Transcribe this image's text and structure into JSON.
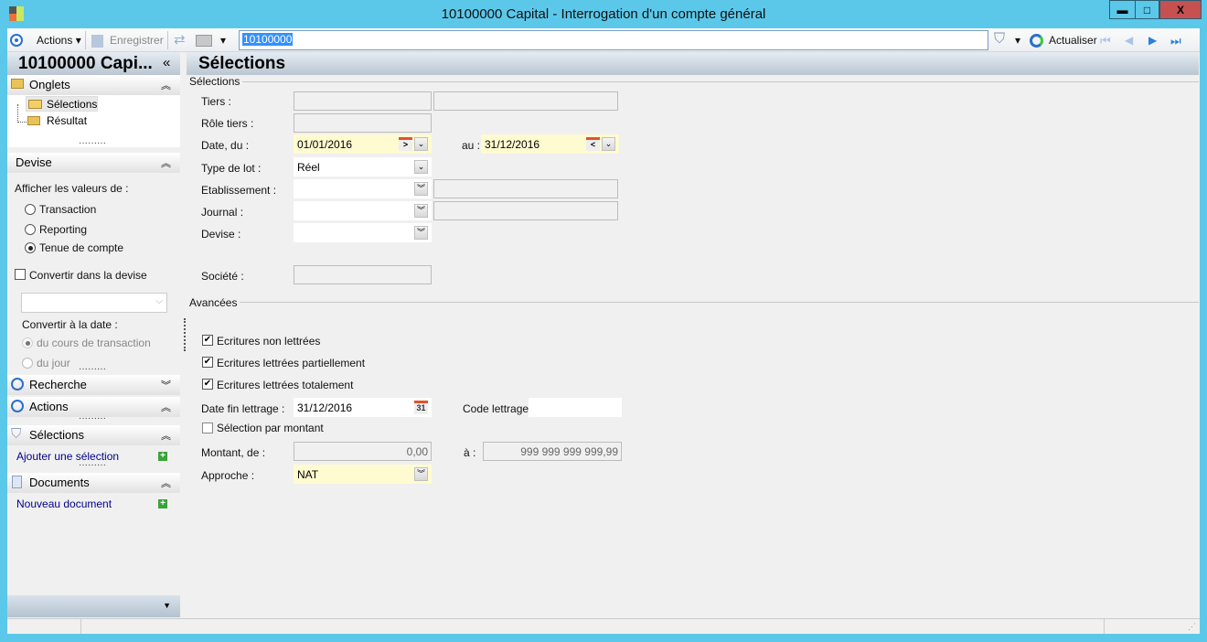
{
  "window": {
    "title": "10100000 Capital -  Interrogation d'un compte général",
    "minimize": "▬",
    "maximize": "□",
    "close": "X"
  },
  "toolbar": {
    "actions": "Actions",
    "save": "Enregistrer",
    "search_value": "10100000",
    "refresh": "Actualiser"
  },
  "left": {
    "title": "10100000 Capi...",
    "collapse": "«",
    "onglets": {
      "label": "Onglets",
      "items": [
        "Sélections",
        "Résultat"
      ]
    },
    "devise": {
      "label": "Devise",
      "afficher": "Afficher les valeurs de :",
      "options": [
        "Transaction",
        "Reporting",
        "Tenue de compte"
      ],
      "selected": 2,
      "convertir": "Convertir dans la devise",
      "convertir_date": "Convertir à la date :",
      "date_options": [
        "du cours de transaction",
        "du jour"
      ]
    },
    "recherche": "Recherche",
    "actions": "Actions",
    "selections": "Sélections",
    "add_selection": "Ajouter une sélection",
    "documents": "Documents",
    "new_document": "Nouveau document"
  },
  "main": {
    "title": "Sélections",
    "section1": "Sélections",
    "section2": "Avancées",
    "tiers": "Tiers :",
    "role": "Rôle tiers :",
    "date_du": "Date, du :",
    "date_from": "01/01/2016",
    "au": "au :",
    "date_to": "31/12/2016",
    "type_lot": "Type de lot :",
    "type_lot_value": "Réel",
    "etab": "Etablissement :",
    "journal": "Journal :",
    "devise": "Devise :",
    "societe": "Société :",
    "chk1": "Ecritures non lettrées",
    "chk2": "Ecritures lettrées partiellement",
    "chk3": "Ecritures lettrées totalement",
    "date_fin": "Date fin lettrage :",
    "date_fin_value": "31/12/2016",
    "cal_day": "31",
    "code": "Code lettrage :",
    "sel_montant": "Sélection par montant",
    "montant": "Montant, de :",
    "montant_from": "0,00",
    "a": "à :",
    "montant_to": "999 999 999 999,99",
    "approche": "Approche :",
    "approche_value": "NAT"
  }
}
